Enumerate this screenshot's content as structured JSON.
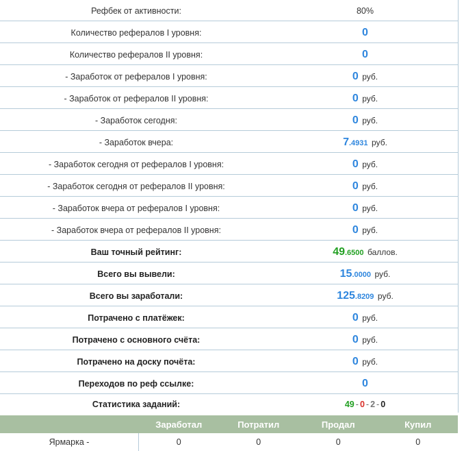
{
  "stats": [
    {
      "label": "Рефбек от активности:",
      "plain": "80%"
    },
    {
      "label": "Количество рефералов I уровня:",
      "int": "0"
    },
    {
      "label": "Количество рефералов II уровня:",
      "int": "0"
    },
    {
      "label": "- Заработок от рефералов I уровня:",
      "int": "0",
      "unit": "руб."
    },
    {
      "label": "- Заработок от рефералов II уровня:",
      "int": "0",
      "unit": "руб."
    },
    {
      "label": "- Заработок сегодня:",
      "int": "0",
      "unit": "руб."
    },
    {
      "label": "- Заработок вчера:",
      "int": "7",
      "frac": ".4931",
      "unit": "руб."
    },
    {
      "label": "- Заработок сегодня от рефералов I уровня:",
      "int": "0",
      "unit": "руб."
    },
    {
      "label": "- Заработок сегодня от рефералов II уровня:",
      "int": "0",
      "unit": "руб."
    },
    {
      "label": "- Заработок вчера от рефералов I уровня:",
      "int": "0",
      "unit": "руб."
    },
    {
      "label": "- Заработок вчера от рефералов II уровня:",
      "int": "0",
      "unit": "руб."
    },
    {
      "label": "Ваш точный рейтинг:",
      "int": "49",
      "frac": ".6500",
      "unit": "баллов.",
      "color": "#23a023"
    },
    {
      "label": "Всего вы вывели:",
      "int": "15",
      "frac": ".0000",
      "unit": "руб."
    },
    {
      "label": "Всего вы заработали:",
      "int": "125",
      "frac": ".8209",
      "unit": "руб."
    },
    {
      "label": "Потрачено с платёжек:",
      "int": "0",
      "unit": "руб."
    },
    {
      "label": "Потрачено с основного счёта:",
      "int": "0",
      "unit": "руб."
    },
    {
      "label": "Потрачено на доску почёта:",
      "int": "0",
      "unit": "руб."
    },
    {
      "label": "Переходов по реф ссылке:",
      "int": "0"
    },
    {
      "label": "Статистика заданий:",
      "tasks": {
        "completed": "49",
        "rejected": "0",
        "pending": "2",
        "other": "0",
        "separator": "-"
      }
    }
  ],
  "market": {
    "headers": [
      "Заработал",
      "Потратил",
      "Продал",
      "Купил"
    ],
    "row": {
      "label": "Ярмарка -",
      "values": [
        "0",
        "0",
        "0",
        "0"
      ]
    }
  },
  "colors": {
    "accent_blue": "#2e86de",
    "accent_green": "#23a023",
    "task_red": "#d9302a",
    "header_bg": "#a8bfa1",
    "grid": "#b5cbd9"
  }
}
